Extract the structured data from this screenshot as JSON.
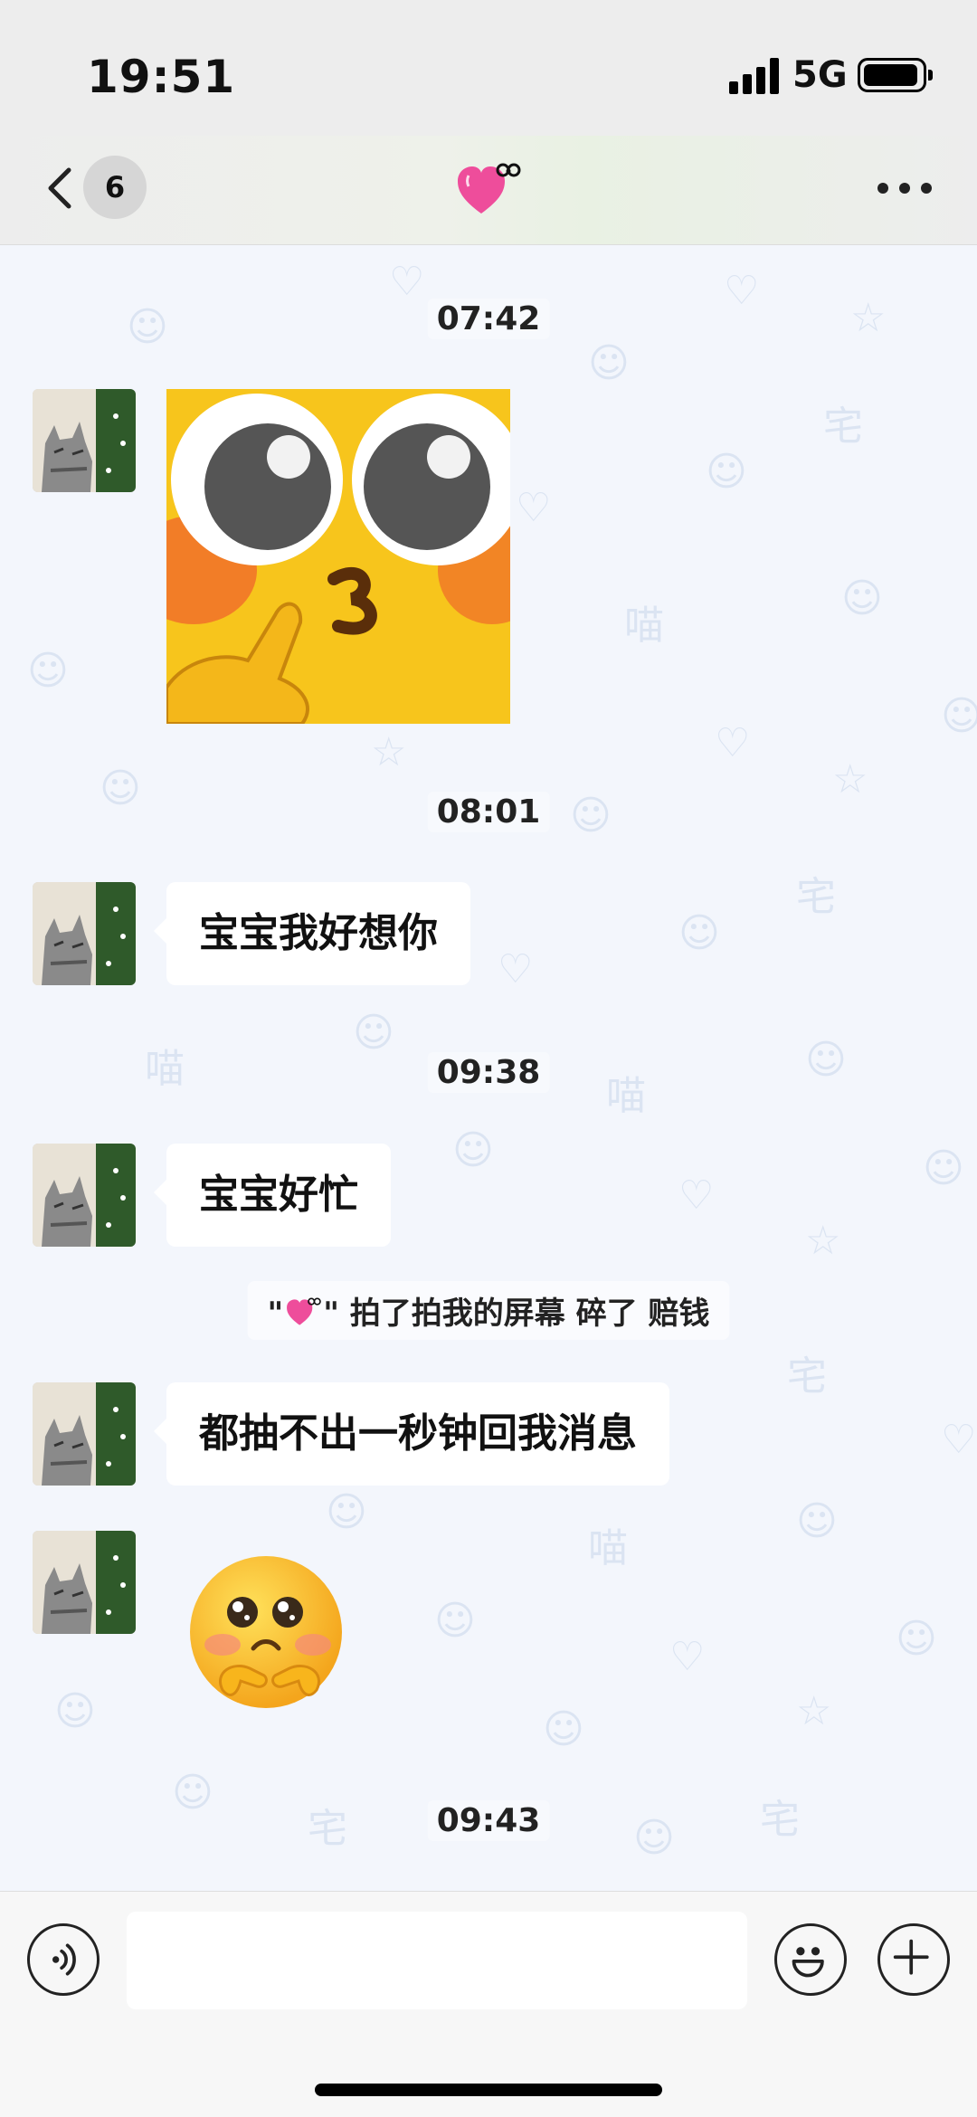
{
  "status_bar": {
    "time": "19:51",
    "network": "5G",
    "battery_level": 0.95
  },
  "nav": {
    "back_badge": "6",
    "title_icon": "pink-heart-with-bow-icon",
    "more_icon": "more-dots-icon"
  },
  "messages": [
    {
      "type": "timestamp",
      "text": "07:42"
    },
    {
      "type": "image",
      "sender": "contact",
      "image_icon": "blushing-kiss-emoji-sticker"
    },
    {
      "type": "timestamp",
      "text": "08:01"
    },
    {
      "type": "text",
      "sender": "contact",
      "text": "宝宝我好想你"
    },
    {
      "type": "timestamp",
      "text": "09:38"
    },
    {
      "type": "text",
      "sender": "contact",
      "text": "宝宝好忙"
    },
    {
      "type": "system",
      "quote_open": "\"",
      "icon": "pink-heart-with-bow-icon",
      "quote_close": "\"",
      "text": "拍了拍我的屏幕 碎了 赔钱"
    },
    {
      "type": "text",
      "sender": "contact",
      "text": "都抽不出一秒钟回我消息"
    },
    {
      "type": "image",
      "sender": "contact",
      "image_icon": "pleading-fingers-emoji"
    },
    {
      "type": "timestamp",
      "text": "09:43"
    }
  ],
  "input_bar": {
    "voice_icon": "voice-icon",
    "emoji_icon": "smiley-icon",
    "add_icon": "plus-icon"
  },
  "colors": {
    "background": "#f3f6fc",
    "bubble": "#ffffff",
    "bar": "#ededed",
    "doodle": "#dbe4f2"
  }
}
